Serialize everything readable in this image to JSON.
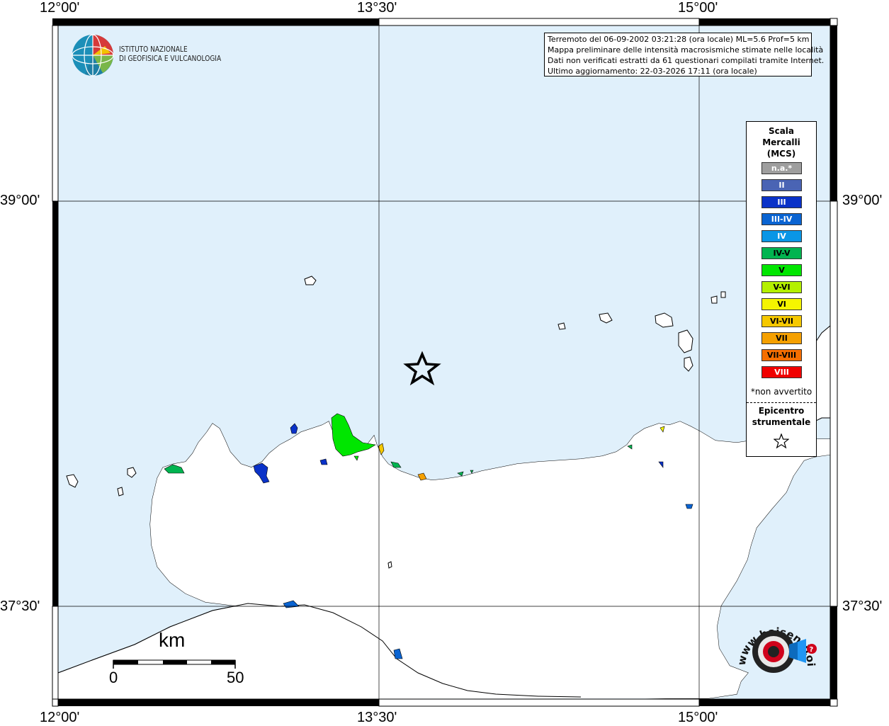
{
  "map": {
    "longitude_labels": [
      "12°00'",
      "13°30'",
      "15°00'"
    ],
    "latitude_labels": [
      "39°00'",
      "37°30'"
    ]
  },
  "info": {
    "line1": "Terremoto del 06-09-2002 03:21:28 (ora locale) ML=5.6 Prof=5 km",
    "line2": "Mappa preliminare delle intensità macrosismiche stimate nelle località",
    "line3": "Dati non verificati estratti da 61 questionari compilati tramite Internet.",
    "line4": "Ultimo aggiornamento: 22-03-2026 17:11 (ora locale)"
  },
  "logo": {
    "line1": "ISTITUTO NAZIONALE",
    "line2": "DI GEOFISICA E VULCANOLOGIA"
  },
  "legend": {
    "title_line1": "Scala",
    "title_line2": "Mercalli",
    "title_line3": "(MCS)",
    "items": [
      {
        "label": "n.a.*",
        "color": "#9e9e9e",
        "text_color": "#ffffff"
      },
      {
        "label": "II",
        "color": "#4a64b4",
        "text_color": "#ffffff"
      },
      {
        "label": "III",
        "color": "#0a32c8",
        "text_color": "#ffffff"
      },
      {
        "label": "III-IV",
        "color": "#0a64d2",
        "text_color": "#ffffff"
      },
      {
        "label": "IV",
        "color": "#0a96e6",
        "text_color": "#ffffff"
      },
      {
        "label": "IV-V",
        "color": "#00b450",
        "text_color": "#000000"
      },
      {
        "label": "V",
        "color": "#00e600",
        "text_color": "#000000"
      },
      {
        "label": "V-VI",
        "color": "#b4f000",
        "text_color": "#000000"
      },
      {
        "label": "VI",
        "color": "#f5f500",
        "text_color": "#000000"
      },
      {
        "label": "VI-VII",
        "color": "#f5c800",
        "text_color": "#000000"
      },
      {
        "label": "VII",
        "color": "#f5a000",
        "text_color": "#000000"
      },
      {
        "label": "VII-VIII",
        "color": "#f56e00",
        "text_color": "#000000"
      },
      {
        "label": "VIII",
        "color": "#f00000",
        "text_color": "#ffffff"
      }
    ],
    "note": "*non avvertito",
    "epicenter_line1": "Epicentro",
    "epicenter_line2": "strumentale"
  },
  "scalebar": {
    "unit": "km",
    "min_label": "0",
    "max_label": "50"
  },
  "brand": {
    "text": "www.haisentitoilterremoto.it"
  },
  "colors": {
    "sea": "#e0f0fb",
    "land": "#ffffff"
  }
}
